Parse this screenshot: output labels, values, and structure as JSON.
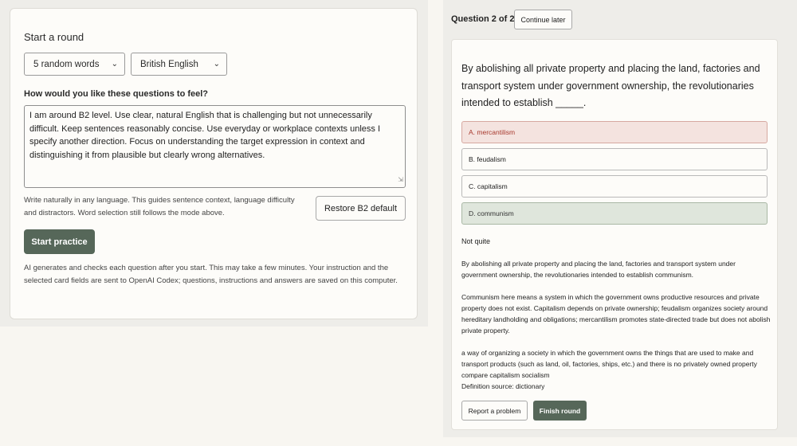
{
  "setup": {
    "title": "Start a round",
    "mode_select": {
      "value": "5 random words"
    },
    "language_select": {
      "value": "British English"
    },
    "feel_label": "How would you like these questions to feel?",
    "instruction_text": "I am around B2 level. Use clear, natural English that is challenging but not unnecessarily difficult. Keep sentences reasonably concise. Use everyday or workplace contexts unless I specify another direction. Focus on understanding the target expression in context and distinguishing it from plausible but clearly wrong alternatives.",
    "hint": "Write naturally in any language. This guides sentence context, language difficulty and distractors. Word selection still follows the mode above.",
    "restore_label": "Restore B2 default",
    "start_label": "Start practice",
    "ai_note": "AI generates and checks each question after you start. This may take a few minutes. Your instruction and the selected card fields are sent to OpenAI Codex; questions, instructions and answers are saved on this computer."
  },
  "quiz": {
    "counter": "Question 2 of 2",
    "continue_label": "Continue later",
    "question": "By abolishing all private property and placing the land, factories and transport system under government ownership, the revolutionaries intended to establish _____.",
    "options": [
      {
        "label": "A. mercantilism",
        "state": "wrong"
      },
      {
        "label": "B. feudalism",
        "state": "neutral"
      },
      {
        "label": "C. capitalism",
        "state": "neutral"
      },
      {
        "label": "D. communism",
        "state": "correct"
      }
    ],
    "feedback": {
      "verdict": "Not quite",
      "answer_sentence": "By abolishing all private property and placing the land, factories and transport system under government ownership, the revolutionaries intended to establish communism.",
      "explanation": "Communism here means a system in which the government owns productive resources and private property does not exist. Capitalism depends on private ownership; feudalism organizes society around hereditary landholding and obligations; mercantilism promotes state-directed trade but does not abolish private property.",
      "definition": "a way of organizing a society in which the government owns the things that are used to make and transport products (such as land, oil, factories, ships, etc.) and there is no privately owned property compare capitalism socialism",
      "source": "Definition source: dictionary"
    },
    "report_label": "Report a problem",
    "finish_label": "Finish round"
  },
  "colors": {
    "primary_button": "#566759",
    "wrong_bg": "#f4e3df",
    "wrong_text": "#a83a2e",
    "correct_bg": "#dfe6dc"
  }
}
